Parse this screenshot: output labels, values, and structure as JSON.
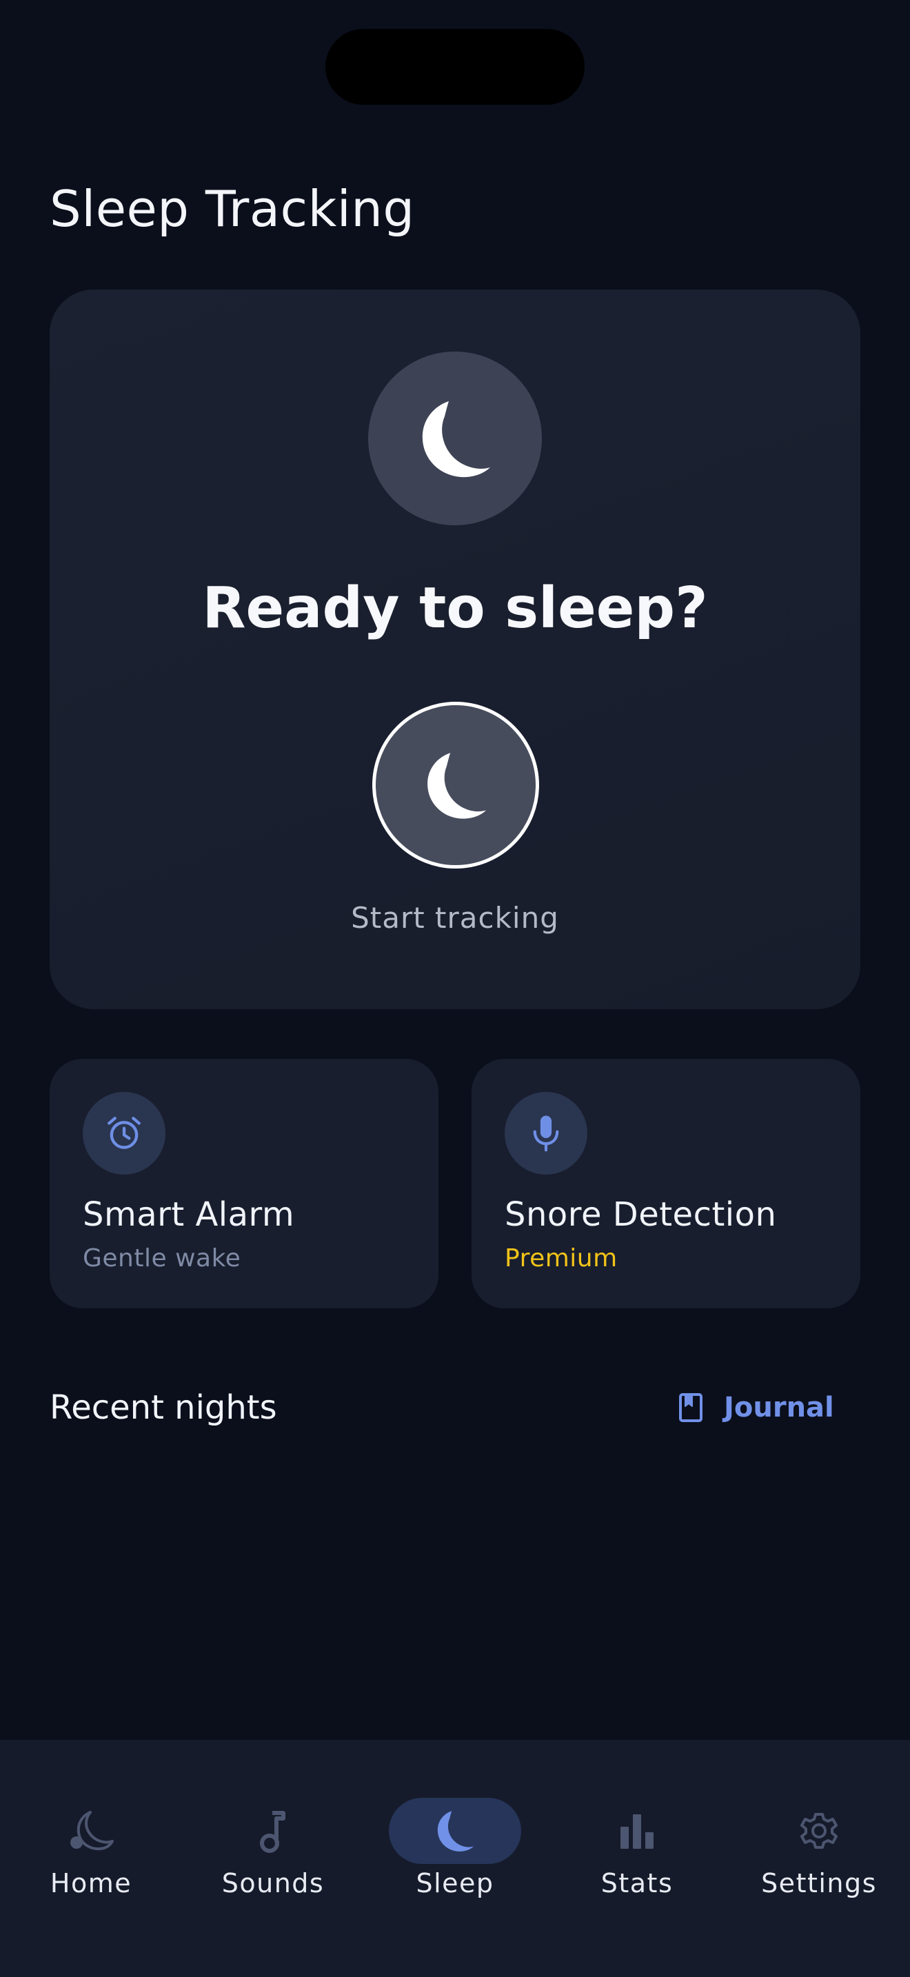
{
  "screen": {
    "title": "Sleep Tracking"
  },
  "hero": {
    "title": "Ready to sleep?",
    "start_label": "Start tracking",
    "icon": "moon-icon"
  },
  "features": [
    {
      "title": "Smart Alarm",
      "subtitle": "Gentle wake",
      "icon": "alarm-clock-icon"
    },
    {
      "title": "Snore Detection",
      "subtitle": "Premium",
      "icon": "microphone-icon",
      "subtitle_color": "#f2c318"
    }
  ],
  "recent": {
    "title": "Recent nights",
    "journal_label": "Journal",
    "journal_icon": "bookmark-book-icon"
  },
  "nav": {
    "active": "Sleep",
    "items": [
      {
        "label": "Home",
        "icon": "moon-stars-icon"
      },
      {
        "label": "Sounds",
        "icon": "music-note-icon"
      },
      {
        "label": "Sleep",
        "icon": "moon-icon"
      },
      {
        "label": "Stats",
        "icon": "bar-chart-icon"
      },
      {
        "label": "Settings",
        "icon": "gear-icon"
      }
    ]
  },
  "colors": {
    "background": "#0b0f1c",
    "card": "#181e2e",
    "accent": "#7191e8",
    "premium": "#f2c318",
    "muted_text": "#7f8aa5"
  }
}
